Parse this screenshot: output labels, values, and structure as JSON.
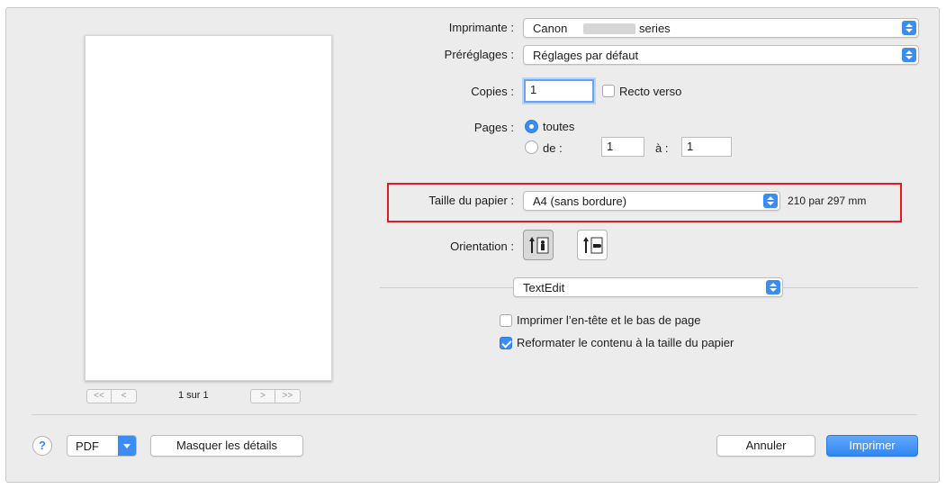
{
  "printer": {
    "label": "Imprimante :",
    "value_prefix": "Canon",
    "value_suffix": "series"
  },
  "presets": {
    "label": "Préréglages :",
    "value": "Réglages par défaut"
  },
  "copies": {
    "label": "Copies :",
    "value": "1",
    "duplex_label": "Recto verso",
    "duplex_checked": false
  },
  "pages": {
    "label": "Pages :",
    "all_label": "toutes",
    "range_label": "de :",
    "from": "1",
    "to_label": "à :",
    "to": "1",
    "selected": "toutes"
  },
  "paper_size": {
    "label": "Taille du papier :",
    "value": "A4 (sans bordure)",
    "dimensions": "210 par 297 mm"
  },
  "orientation": {
    "label": "Orientation :",
    "selected": "portrait"
  },
  "app_section": {
    "value": "TextEdit"
  },
  "options": {
    "header_footer_label": "Imprimer l’en-tête et le bas de page",
    "header_footer_checked": false,
    "rescale_label": "Reformater le contenu à la taille du papier",
    "rescale_checked": true
  },
  "preview": {
    "page_count": "1 sur 1",
    "first": "<<",
    "prev": "<",
    "next": ">",
    "last": ">>"
  },
  "footer": {
    "help": "?",
    "pdf": "PDF",
    "hide_details": "Masquer les détails",
    "cancel": "Annuler",
    "print": "Imprimer"
  },
  "colors": {
    "accent": "#3b8df3",
    "highlight": "#e8191e"
  },
  "icons": {
    "popup": "stepper-icon",
    "orientation_portrait": "portrait-orientation-icon",
    "orientation_landscape": "landscape-orientation-icon"
  }
}
